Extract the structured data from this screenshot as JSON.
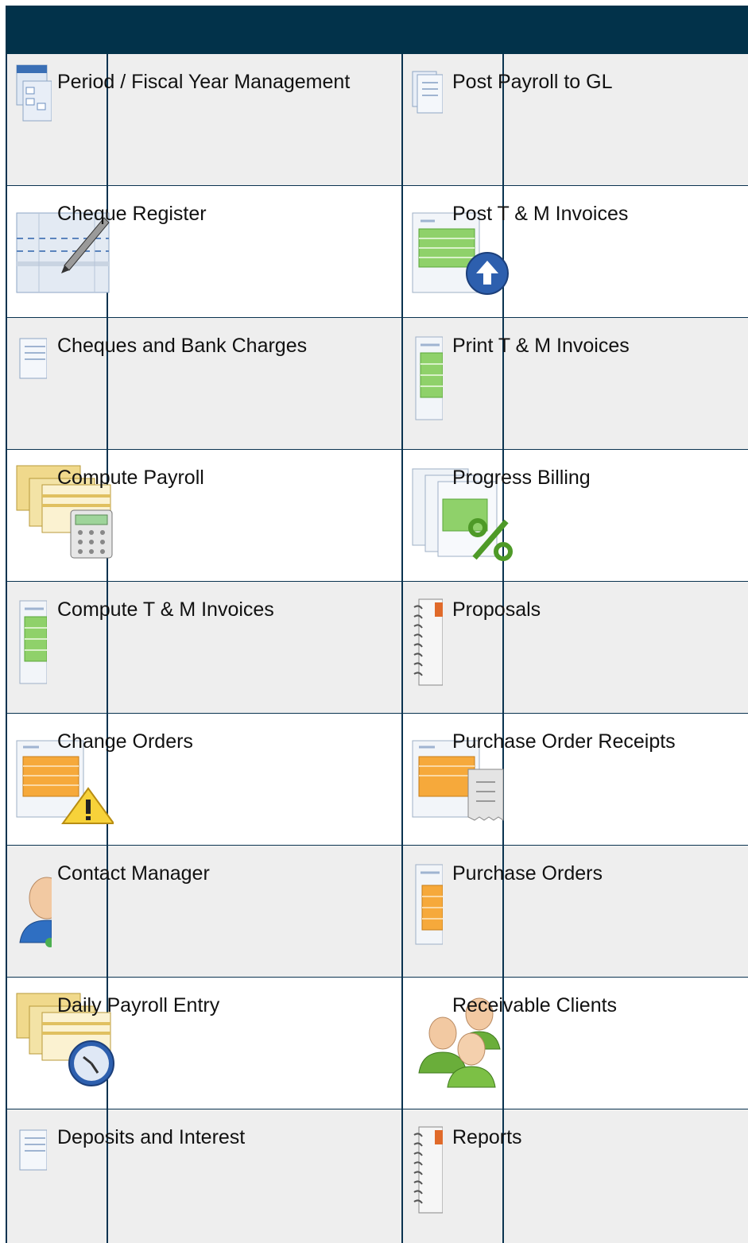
{
  "header": {
    "title": ""
  },
  "rows": [
    {
      "left": {
        "label": "Period / Fiscal Year Management",
        "icon": "calendar-pages-icon"
      },
      "right": {
        "label": "Post Payroll to GL",
        "icon": "document-pages-icon"
      }
    },
    {
      "left": {
        "label": "Cheque Register",
        "icon": "register-pencil-icon"
      },
      "right": {
        "label": "Post T & M Invoices",
        "icon": "invoice-upload-icon"
      }
    },
    {
      "left": {
        "label": "Cheques and Bank Charges",
        "icon": "document-icon"
      },
      "right": {
        "label": "Print T & M Invoices",
        "icon": "invoice-green-icon"
      }
    },
    {
      "left": {
        "label": "Compute Payroll",
        "icon": "payroll-calculator-icon"
      },
      "right": {
        "label": "Progress Billing",
        "icon": "percent-billing-icon"
      }
    },
    {
      "left": {
        "label": "Compute T & M Invoices",
        "icon": "invoice-green-icon"
      },
      "right": {
        "label": "Proposals",
        "icon": "spiral-notebook-icon"
      }
    },
    {
      "left": {
        "label": "Change Orders",
        "icon": "order-warning-icon"
      },
      "right": {
        "label": "Purchase Order Receipts",
        "icon": "order-receipt-icon"
      }
    },
    {
      "left": {
        "label": "Contact Manager",
        "icon": "contact-person-icon"
      },
      "right": {
        "label": "Purchase Orders",
        "icon": "purchase-order-icon"
      }
    },
    {
      "left": {
        "label": "Daily Payroll Entry",
        "icon": "payroll-clock-icon"
      },
      "right": {
        "label": "Receivable Clients",
        "icon": "people-group-icon"
      }
    },
    {
      "left": {
        "label": "Deposits and Interest",
        "icon": "document-icon"
      },
      "right": {
        "label": "Reports",
        "icon": "spiral-notebook-icon"
      }
    }
  ],
  "colors": {
    "header": "#02324a",
    "grid_line": "#0a3350",
    "row_shade": "#eeeeee"
  }
}
